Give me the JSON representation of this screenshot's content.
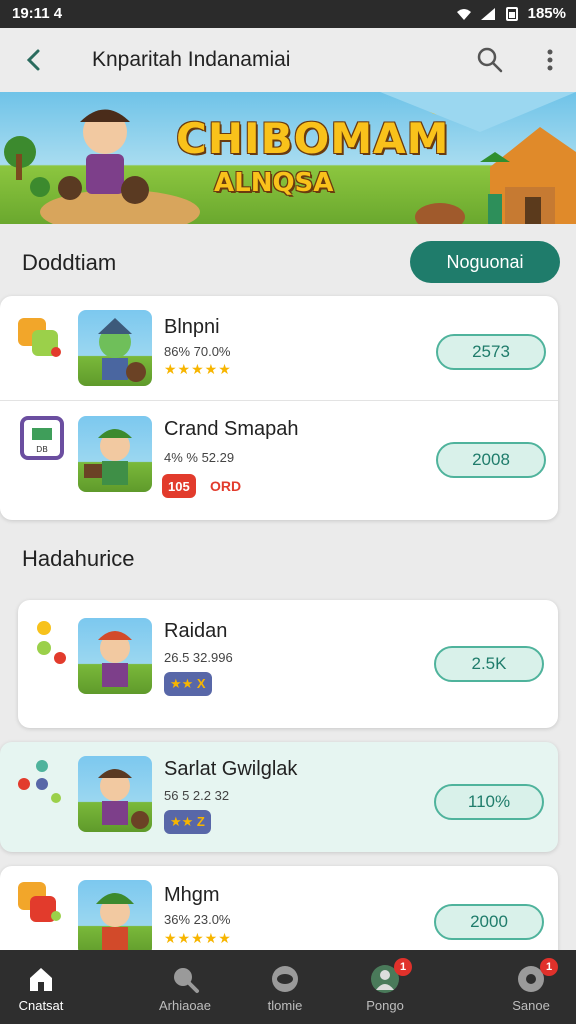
{
  "status_bar": {
    "time": "19:11 4",
    "battery": "185%"
  },
  "app_bar": {
    "title": "Knparitah Indanamiai"
  },
  "banner": {
    "title": "CHIBOMAM",
    "subtitle": "ALNQSA"
  },
  "section1": {
    "title": "Doddtiam",
    "button_label": "Noguonai",
    "apps": [
      {
        "name": "Blnpni",
        "meta": "86% 70.0%",
        "stars": "★★★★★",
        "action": "2573"
      },
      {
        "name": "Crand Smapah",
        "meta": "4% % 52.29",
        "tag": "105",
        "tag_extra": "ORD",
        "action": "2008"
      }
    ]
  },
  "section2": {
    "title": "Hadahurice",
    "apps": [
      {
        "name": "Raidan",
        "meta": "26.5 32.996",
        "tag": "★★ X",
        "action": "2.5K"
      },
      {
        "name": "Sarlat Gwilglak",
        "meta": "56 5 2.2 32",
        "tag": "★★ Z",
        "action": "110%"
      },
      {
        "name": "Mhgm",
        "meta": "36% 23.0%",
        "stars": "★★★★★",
        "action": "2000"
      }
    ]
  },
  "bottom_nav": [
    {
      "label": "Cnatsat",
      "icon": "home-icon"
    },
    {
      "label": "Arhiaoae",
      "icon": "search-icon"
    },
    {
      "label": "tlomie",
      "icon": "gamepad-icon"
    },
    {
      "label": "Pongo",
      "icon": "profile-icon",
      "badge": "1"
    },
    {
      "label": "Sanoe",
      "icon": "settings-icon",
      "badge": "1"
    }
  ],
  "colors": {
    "accent": "#1f7c6b",
    "accent_light": "#d9f1ea",
    "star": "#f7b500"
  }
}
